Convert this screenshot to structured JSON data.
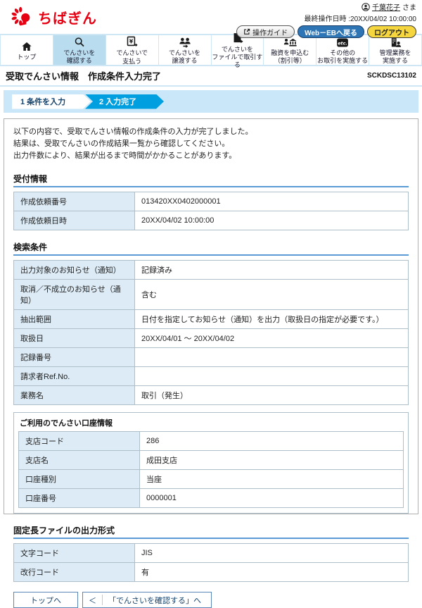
{
  "header": {
    "logo_text": "ちばぎん",
    "user_name": "千葉花子",
    "user_suffix": "さま",
    "last_operation": "最終操作日時 :20XX/04/02 10:00:00",
    "guide_button": "操作ガイド",
    "webeb_button": "Web－EBへ戻る",
    "logout_button": "ログアウト"
  },
  "nav": {
    "items": [
      {
        "label": "トップ",
        "icon": "home-icon",
        "active": false
      },
      {
        "label": "でんさいを\n確認する",
        "icon": "search-icon",
        "active": true
      },
      {
        "label": "でんさいで\n支払う",
        "icon": "yen-document-icon",
        "active": false
      },
      {
        "label": "でんさいを\n譲渡する",
        "icon": "people-transfer-icon",
        "active": false
      },
      {
        "label": "でんさいを\nファイルで取引する",
        "icon": "file-transfer-icon",
        "active": false
      },
      {
        "label": "融資を申込む\n（割引等）",
        "icon": "loan-bank-icon",
        "active": false
      },
      {
        "label": "その他の\nお取引を実施する",
        "icon": "etc-icon",
        "active": false
      },
      {
        "label": "管理業務を\n実施する",
        "icon": "building-person-icon",
        "active": false
      }
    ]
  },
  "page": {
    "title": "受取でんさい情報　作成条件入力完了",
    "screen_code": "SCKDSC13102"
  },
  "steps": [
    {
      "label": "1 条件を入力",
      "active": false
    },
    {
      "label": "2 入力完了",
      "active": true
    }
  ],
  "message": {
    "line1": "以下の内容で、受取でんさい情報の作成条件の入力が完了しました。",
    "line2": "結果は、受取でんさいの作成結果一覧から確認してください。",
    "line3": "出力件数により、結果が出るまで時間がかかることがあります。"
  },
  "sections": {
    "reception": {
      "title": "受付情報",
      "rows": [
        {
          "label": "作成依頼番号",
          "value": "013420XX0402000001"
        },
        {
          "label": "作成依頼日時",
          "value": "20XX/04/02 10:00:00"
        }
      ]
    },
    "search": {
      "title": "検索条件",
      "rows": [
        {
          "label": "出力対象のお知らせ（通知）",
          "value": "記録済み"
        },
        {
          "label": "取消／不成立のお知らせ（通知）",
          "value": "含む"
        },
        {
          "label": "抽出範囲",
          "value": "日付を指定してお知らせ（通知）を出力（取扱日の指定が必要です。）"
        },
        {
          "label": "取扱日",
          "value": "20XX/04/01 ～ 20XX/04/02"
        },
        {
          "label": "記録番号",
          "value": ""
        },
        {
          "label": "請求者Ref.No.",
          "value": ""
        },
        {
          "label": "業務名",
          "value": "取引（発生）"
        }
      ],
      "account": {
        "title": "ご利用のでんさい口座情報",
        "rows": [
          {
            "label": "支店コード",
            "value": "286"
          },
          {
            "label": "支店名",
            "value": "成田支店"
          },
          {
            "label": "口座種別",
            "value": "当座"
          },
          {
            "label": "口座番号",
            "value": "0000001"
          }
        ]
      }
    },
    "fixed_file": {
      "title": "固定長ファイルの出力形式",
      "rows": [
        {
          "label": "文字コード",
          "value": "JIS"
        },
        {
          "label": "改行コード",
          "value": "有"
        }
      ]
    }
  },
  "footer": {
    "top_button": "トップへ",
    "back_chevron": "＜",
    "back_button": "「でんさいを確認する」へ"
  },
  "colors": {
    "brand_red": "#e60012",
    "webeb_blue": "#2e75b6",
    "logout_yellow": "#f5d63f",
    "active_step_blue": "#00a0e0",
    "nav_active_bg": "#b9dcee",
    "table_label_bg": "#dcebf5",
    "section_underline": "#5b9bd5"
  }
}
